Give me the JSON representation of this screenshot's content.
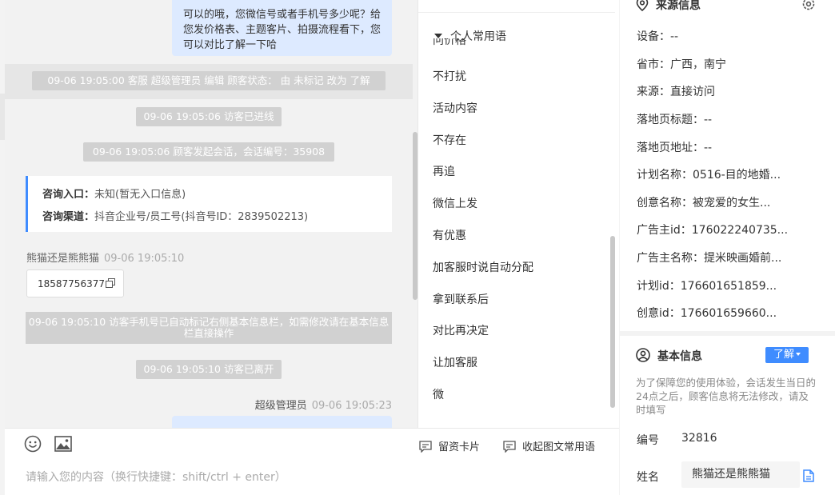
{
  "chat": {
    "top_message": "可以的哦，您微信号或者手机号多少呢？给您发价格表、主题客片、拍摄流程看下，您可以对比了解一下哈",
    "sys_status_change": "09-06 19:05:00 客服 超级管理员 编辑 顾客状态： 由 未标记 改为 了解",
    "sys_entered": "09-06 19:05:06 访客已进线",
    "sys_session": "09-06 19:05:06 顾客发起会话，会话编号：35908",
    "info_card": {
      "entry_label": "咨询入口：",
      "entry_value": "未知(暂无入口信息)",
      "channel_label": "咨询渠道：",
      "channel_value": "抖音企业号/员工号(抖音号ID：2839502213)"
    },
    "visitor_name": "熊猫还是熊熊猫",
    "visitor_time": "09-06 19:05:10",
    "phone": "18587756377",
    "sys_phone_marked": "09-06 19:05:10 访客手机号已自动标记右侧基本信息栏，如需修改请在基本信息栏直接操作",
    "sys_left": "09-06 19:05:10 访客已离开",
    "agent_name": "超级管理员",
    "agent_time": "09-06 19:05:23"
  },
  "phrases": {
    "group_label": "个人常用语",
    "partial_item": "问价格",
    "items": [
      "不打扰",
      "活动内容",
      "不存在",
      "再追",
      "微信上发",
      "有优惠",
      "加客服时说自动分配",
      "拿到联系后",
      "对比再决定",
      "让加客服",
      "微"
    ]
  },
  "input": {
    "card_button": "留资卡片",
    "collapse_button": "收起图文常用语",
    "placeholder": "请输入您的内容（换行快捷键：shift/ctrl + enter）"
  },
  "source_info": {
    "title": "来源信息",
    "rows": [
      "设备：--",
      "省市：广西，南宁",
      "来源：直接访问",
      "落地页标题：--",
      "落地页地址：--",
      "计划名称：0516-目的地婚...",
      "创意名称：被宠爱的女生...",
      "广告主id：176022240735...",
      "广告主名称：提米映画婚前...",
      "计划id：176601651859...",
      "创意id：176601659660..."
    ]
  },
  "basic_info": {
    "title": "基本信息",
    "learn_button": "了解",
    "notice": "为了保障您的使用体验，会话发生当日的24点之后，顾客信息将无法修改，请及时填写",
    "id_label": "编号",
    "id_value": "32816",
    "name_label": "姓名",
    "name_value": "熊猫还是熊熊猫"
  }
}
